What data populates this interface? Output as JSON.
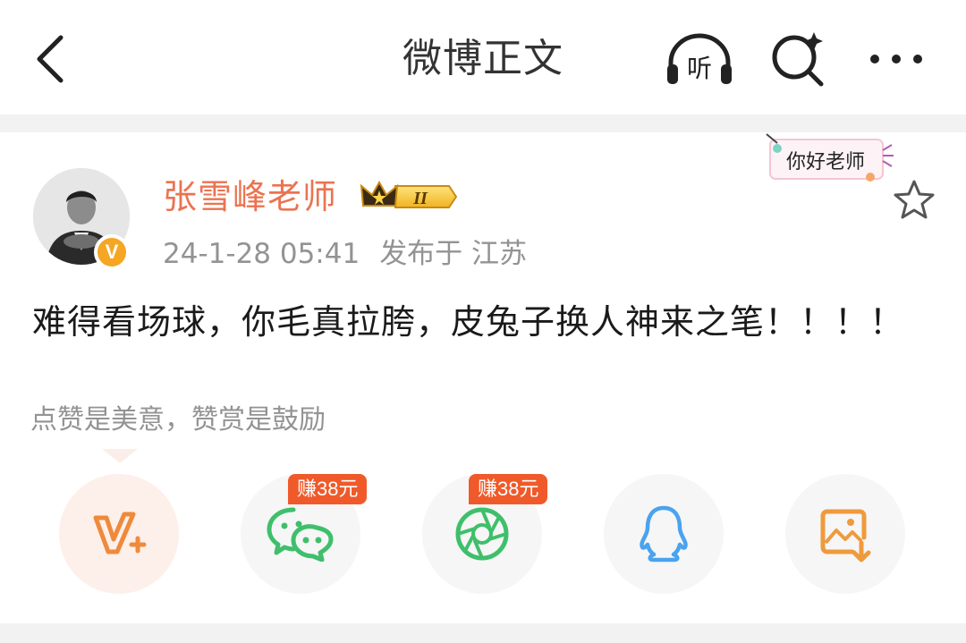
{
  "header": {
    "title": "微博正文",
    "icons": [
      "back-icon",
      "listen-icon",
      "search-icon",
      "more-icon"
    ],
    "listen_label": "听"
  },
  "post": {
    "author": "张雪峰老师",
    "verified_badge": "V",
    "vip_level": "II",
    "timestamp": "24-1-28 05:41",
    "publish_location": "发布于 江苏",
    "sticker_text": "你好老师",
    "content": "难得看场球，你毛真拉胯，皮兔子换人神来之笔！！！！"
  },
  "reward": {
    "tip": "点赞是美意，赞赏是鼓励"
  },
  "share": {
    "items": [
      {
        "name": "reward",
        "icon": "v-plus-icon"
      },
      {
        "name": "wechat",
        "icon": "wechat-icon",
        "tag": "赚38元"
      },
      {
        "name": "moments",
        "icon": "moments-icon",
        "tag": "赚38元"
      },
      {
        "name": "qq",
        "icon": "qq-icon"
      },
      {
        "name": "save-image",
        "icon": "save-image-icon"
      }
    ]
  },
  "colors": {
    "username": "#eb7350",
    "meta_gray": "#939393",
    "earn_tag": "#f05a2a",
    "wechat_green": "#3fbf6b",
    "qq_blue": "#4aa3ee",
    "reward_orange": "#ef8a3c"
  }
}
